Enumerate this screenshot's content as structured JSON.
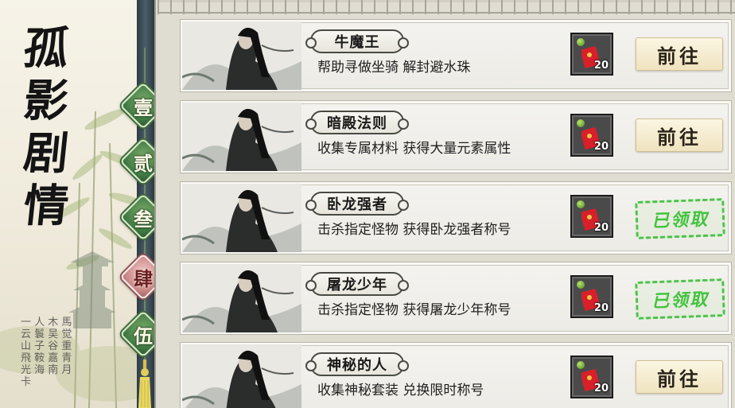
{
  "title": {
    "chars": [
      "孤",
      "影",
      "剧",
      "情"
    ]
  },
  "seal_text": "一 人 木 馬 云 鬟 吴 觉 山 子 谷 重 飛 鞍 嘉 青 光 海 南 月 卡",
  "tabs": [
    {
      "label": "壹",
      "active": false
    },
    {
      "label": "贰",
      "active": false
    },
    {
      "label": "叁",
      "active": false
    },
    {
      "label": "肆",
      "active": true
    },
    {
      "label": "伍",
      "active": false
    }
  ],
  "quests": [
    {
      "name": "牛魔王",
      "desc": "帮助寻做坐骑  解封避水珠",
      "reward_count": "20",
      "action": "前往",
      "status": "go"
    },
    {
      "name": "暗殿法则",
      "desc": "收集专属材料  获得大量元素属性",
      "reward_count": "20",
      "action": "前往",
      "status": "go"
    },
    {
      "name": "卧龙强者",
      "desc": "击杀指定怪物  获得卧龙强者称号",
      "reward_count": "20",
      "action": "已领取",
      "status": "claimed"
    },
    {
      "name": "屠龙少年",
      "desc": "击杀指定怪物  获得屠龙少年称号",
      "reward_count": "20",
      "action": "已领取",
      "status": "claimed"
    },
    {
      "name": "神秘的人",
      "desc": "收集神秘套装  兑换限时称号",
      "reward_count": "20",
      "action": "前往",
      "status": "go"
    }
  ],
  "colors": {
    "tab_green": "#3f7a44",
    "tab_active": "#c98585",
    "claimed_green": "#43c33f",
    "reward_red": "#d8202a"
  },
  "icons": {
    "reward": "red-envelope-icon",
    "reward_dot": "green-dot-icon"
  }
}
